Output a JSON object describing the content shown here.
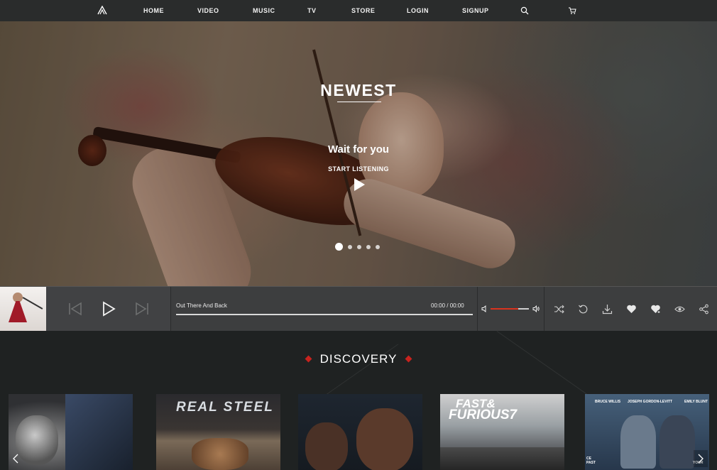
{
  "nav": {
    "logo": "logo",
    "items": [
      "HOME",
      "VIDEO",
      "MUSIC",
      "TV",
      "STORE",
      "LOGIN",
      "SIGNUP"
    ],
    "search_icon": "search-icon",
    "cart_icon": "cart-icon"
  },
  "hero": {
    "title": "NEWEST",
    "subtitle": "Wait for you",
    "cta": "START LISTENING",
    "slides_count": 5,
    "active_slide": 1
  },
  "player": {
    "track_title": "Out There And Back",
    "time": "00:00 / 00:00",
    "progress": 0,
    "volume": 0.72,
    "controls": [
      "previous-icon",
      "play-icon",
      "next-icon"
    ],
    "actions": [
      "shuffle-icon",
      "repeat-icon",
      "download-icon",
      "heart-icon",
      "heart-add-icon",
      "eye-icon",
      "share-icon"
    ]
  },
  "discovery": {
    "title": "DISCOVERY",
    "posters": [
      {
        "id": "x-men",
        "text": ""
      },
      {
        "id": "real-steel",
        "text": "REAL STEEL"
      },
      {
        "id": "after-earth",
        "text": ""
      },
      {
        "id": "fast-furious-7",
        "text_a": "FAST&",
        "text_b": "FURIOUS7"
      },
      {
        "id": "looper",
        "cast": [
          "BRUCE WILLIS",
          "JOSEPH GORDON-LEVITT",
          "EMILY BLUNT"
        ],
        "footer_left": "CE PAST",
        "footer_right": "YOUR"
      }
    ]
  },
  "colors": {
    "accent": "#d9331e",
    "nav_bg": "#2a2c2c",
    "player_bg": "#3d3e3f",
    "discovery_bg": "#1f2222"
  }
}
